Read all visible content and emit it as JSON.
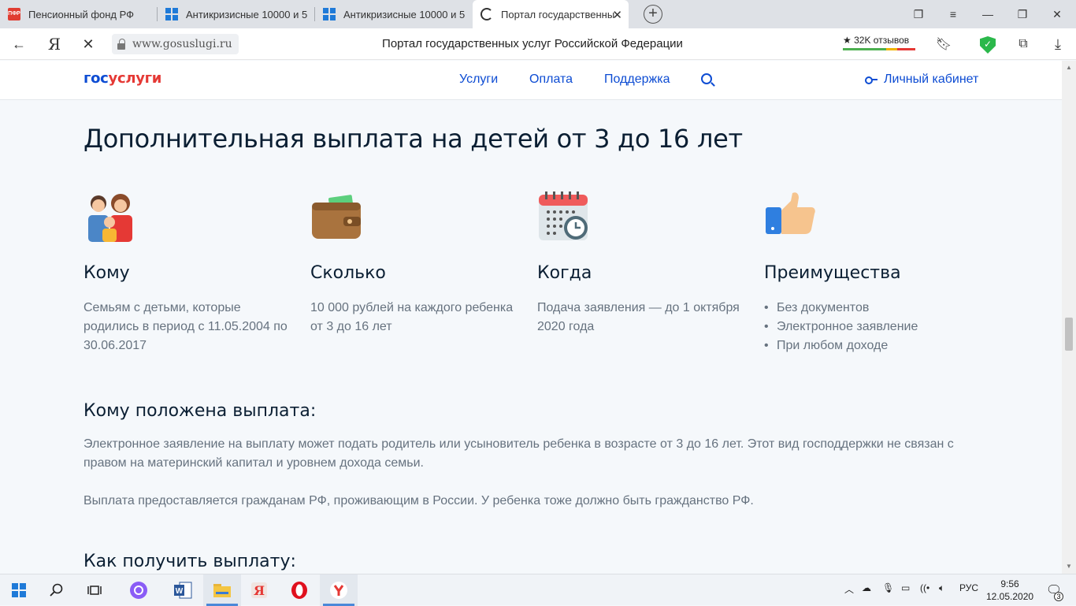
{
  "browser": {
    "tabs": [
      {
        "title": "Пенсионный фонд РФ",
        "icon": "pfr-favicon"
      },
      {
        "title": "Антикризисные 10000 и 5",
        "icon": "windows-favicon"
      },
      {
        "title": "Антикризисные 10000 и 5",
        "icon": "windows-favicon"
      },
      {
        "title": "Портал государственны",
        "icon": "loading-spinner",
        "active": true
      }
    ],
    "url": "www.gosuslugi.ru",
    "page_title": "Портал государственных услуг Российской Федерации",
    "reviews": "32K отзывов"
  },
  "site": {
    "logo_part1": "гос",
    "logo_part2": "услуги",
    "nav": [
      "Услуги",
      "Оплата",
      "Поддержка"
    ],
    "cabinet": "Личный кабинет"
  },
  "page": {
    "title": "Дополнительная выплата на детей от 3 до 16 лет",
    "columns": [
      {
        "title": "Кому",
        "text": "Семьям с детьми, которые родились в период с 11.05.2004 по 30.06.2017",
        "icon": "family-icon"
      },
      {
        "title": "Сколько",
        "text": "10 000 рублей на каждого ребенка от 3 до 16 лет",
        "icon": "wallet-icon"
      },
      {
        "title": "Когда",
        "text": "Подача заявления — до 1 октября 2020 года",
        "icon": "calendar-clock-icon"
      },
      {
        "title": "Преимущества",
        "bullets": [
          "Без документов",
          "Электронное заявление",
          "При любом доходе"
        ],
        "icon": "thumbs-up-icon"
      }
    ],
    "section1_title": "Кому положена выплата:",
    "section1_p1": "Электронное заявление на выплату может подать родитель или усыновитель ребенка в возрасте от 3 до 16 лет. Этот вид господдержки не связан с правом на материнский капитал и уровнем дохода семьи.",
    "section1_p2": "Выплата предоставляется гражданам РФ, проживающим в России. У ребенка тоже должно быть гражданство РФ.",
    "section2_title": "Как получить выплату:"
  },
  "taskbar": {
    "lang": "РУС",
    "time": "9:56",
    "date": "12.05.2020",
    "notifications": "3"
  },
  "colors": {
    "brand_blue": "#0d4cd3",
    "brand_red": "#e53935",
    "text_dark": "#0b1f33",
    "text_gray": "#66727f"
  }
}
